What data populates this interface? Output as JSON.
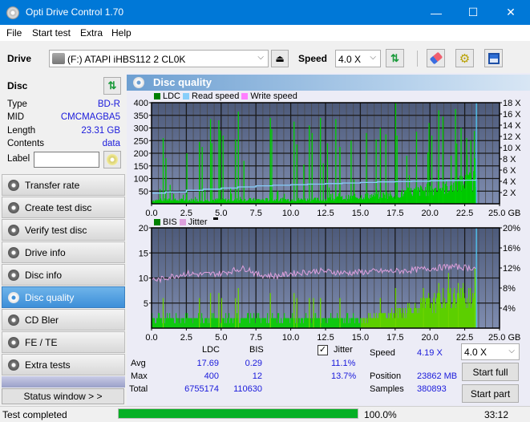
{
  "window": {
    "title": "Opti Drive Control 1.70",
    "minimize": "—",
    "maximize": "☐",
    "close": "✕"
  },
  "menu": [
    "File",
    "Start test",
    "Extra",
    "Help"
  ],
  "toolbar": {
    "drive_label": "Drive",
    "drive_value": "(F:)  ATAPI iHBS112  2 CL0K",
    "speed_label": "Speed",
    "speed_value": "4.0 X",
    "icons": [
      "drive-icon",
      "eject-icon",
      "refresh-icon",
      "eraser-icon",
      "settings-icon",
      "save-icon"
    ]
  },
  "disc": {
    "header": "Disc",
    "fields": [
      {
        "key": "Type",
        "value": "BD-R"
      },
      {
        "key": "MID",
        "value": "CMCMAGBA5"
      },
      {
        "key": "Length",
        "value": "23.31 GB"
      },
      {
        "key": "Contents",
        "value": "data"
      }
    ],
    "label_key": "Label",
    "label_value": ""
  },
  "nav": [
    {
      "label": "Transfer rate",
      "active": false
    },
    {
      "label": "Create test disc",
      "active": false
    },
    {
      "label": "Verify test disc",
      "active": false
    },
    {
      "label": "Drive info",
      "active": false
    },
    {
      "label": "Disc info",
      "active": false
    },
    {
      "label": "Disc quality",
      "active": true
    },
    {
      "label": "CD Bler",
      "active": false
    },
    {
      "label": "FE / TE",
      "active": false
    },
    {
      "label": "Extra tests",
      "active": false
    }
  ],
  "status_window_label": "Status window > >",
  "main": {
    "title": "Disc quality"
  },
  "chart_data": [
    {
      "type": "bar",
      "title": "LDC",
      "legend": [
        "LDC",
        "Read speed",
        "Write speed"
      ],
      "legend_colors": {
        "LDC": "#008000",
        "Read speed": "#87cefa",
        "Write speed": "#ff80ff"
      },
      "xlabel": "GB",
      "x_range": [
        0,
        25
      ],
      "x_ticks": [
        "0.0",
        "2.5",
        "5.0",
        "7.5",
        "10.0",
        "12.5",
        "15.0",
        "17.5",
        "20.0",
        "22.5",
        "25.0 GB"
      ],
      "y_range": [
        0,
        400
      ],
      "y_ticks": [
        "400",
        "350",
        "300",
        "250",
        "200",
        "150",
        "100",
        "50"
      ],
      "y2_range": [
        0,
        18
      ],
      "y2_ticks": [
        "18 X",
        "16 X",
        "14 X",
        "12 X",
        "10 X",
        "8 X",
        "6 X",
        "4 X",
        "2 X"
      ],
      "data_end_gb": 23.31,
      "ldc_baseline": [
        [
          0,
          15
        ],
        [
          12.5,
          18
        ],
        [
          15,
          30
        ],
        [
          17.5,
          40
        ],
        [
          20,
          60
        ],
        [
          22,
          80
        ],
        [
          23.3,
          100
        ]
      ],
      "ldc_spikes": [
        [
          0.8,
          260
        ],
        [
          1.0,
          180
        ],
        [
          1.3,
          75
        ],
        [
          2.5,
          200
        ],
        [
          3.4,
          245
        ],
        [
          3.6,
          225
        ],
        [
          4.2,
          335
        ],
        [
          4.3,
          240
        ],
        [
          4.8,
          330
        ],
        [
          4.9,
          290
        ],
        [
          5.1,
          270
        ],
        [
          6.0,
          255
        ],
        [
          6.2,
          365
        ],
        [
          6.6,
          170
        ],
        [
          8.5,
          340
        ],
        [
          8.6,
          295
        ],
        [
          10.2,
          325
        ],
        [
          10.4,
          235
        ],
        [
          10.9,
          155
        ],
        [
          11.3,
          310
        ],
        [
          11.5,
          280
        ],
        [
          12.1,
          340
        ],
        [
          12.3,
          160
        ],
        [
          12.6,
          240
        ],
        [
          13.2,
          335
        ],
        [
          13.5,
          225
        ],
        [
          14.3,
          250
        ],
        [
          15.4,
          280
        ],
        [
          16.1,
          255
        ],
        [
          16.4,
          300
        ],
        [
          16.8,
          275
        ],
        [
          17.5,
          400
        ],
        [
          17.6,
          270
        ],
        [
          18.3,
          190
        ],
        [
          19.0,
          285
        ],
        [
          19.9,
          320
        ],
        [
          20.1,
          270
        ],
        [
          20.6,
          370
        ],
        [
          20.9,
          345
        ],
        [
          21.8,
          375
        ],
        [
          22.2,
          300
        ],
        [
          22.6,
          260
        ],
        [
          22.9,
          250
        ],
        [
          23.2,
          180
        ]
      ],
      "read_speed_x": [
        [
          0,
          1.9
        ],
        [
          1.0,
          2.1
        ],
        [
          2.5,
          2.4
        ],
        [
          3.7,
          2.6
        ],
        [
          5.0,
          2.8
        ],
        [
          6.2,
          3.0
        ],
        [
          7.5,
          3.2
        ],
        [
          8.7,
          3.3
        ],
        [
          10.0,
          3.4
        ],
        [
          11.2,
          3.5
        ],
        [
          12.5,
          3.6
        ],
        [
          13.7,
          3.7
        ],
        [
          15.0,
          3.8
        ],
        [
          16.2,
          3.9
        ],
        [
          17.5,
          3.95
        ],
        [
          18.7,
          4.0
        ],
        [
          20.0,
          4.1
        ],
        [
          21.2,
          4.15
        ],
        [
          22.5,
          4.2
        ],
        [
          23.3,
          4.35
        ]
      ]
    },
    {
      "type": "bar",
      "title": "BIS",
      "legend": [
        "BIS",
        "Jitter"
      ],
      "legend_colors": {
        "BIS": "#008000",
        "Jitter": "#dda0dd"
      },
      "xlabel": "GB",
      "x_range": [
        0,
        25
      ],
      "x_ticks": [
        "0.0",
        "2.5",
        "5.0",
        "7.5",
        "10.0",
        "12.5",
        "15.0",
        "17.5",
        "20.0",
        "22.5",
        "25.0 GB"
      ],
      "y_range": [
        0,
        20
      ],
      "y_ticks": [
        "20",
        "15",
        "10",
        "5"
      ],
      "y2_range": [
        0,
        20
      ],
      "y2_ticks": [
        "20%",
        "16%",
        "12%",
        "8%",
        "4%"
      ],
      "data_end_gb": 23.31,
      "bis_baseline": [
        [
          0,
          2
        ],
        [
          15,
          2
        ],
        [
          17.5,
          3
        ],
        [
          20,
          5
        ],
        [
          23.3,
          7
        ]
      ],
      "bis_spikes": [
        [
          0.8,
          6
        ],
        [
          3.4,
          6
        ],
        [
          4.2,
          7
        ],
        [
          4.8,
          7
        ],
        [
          5.0,
          6
        ],
        [
          6.0,
          6
        ],
        [
          6.2,
          8
        ],
        [
          8.5,
          7
        ],
        [
          10.2,
          7
        ],
        [
          10.4,
          6
        ],
        [
          11.3,
          6
        ],
        [
          11.6,
          6
        ],
        [
          12.1,
          6
        ],
        [
          13.5,
          6
        ],
        [
          16.4,
          6
        ],
        [
          17.5,
          8
        ],
        [
          19.5,
          8
        ],
        [
          20.6,
          9
        ],
        [
          21.3,
          11
        ],
        [
          22.0,
          9
        ],
        [
          23.2,
          12
        ]
      ],
      "jitter_pct": [
        [
          0,
          9.8
        ],
        [
          0.5,
          9.6
        ],
        [
          1.5,
          10.4
        ],
        [
          2.5,
          10.9
        ],
        [
          3.5,
          10.7
        ],
        [
          5.0,
          10.9
        ],
        [
          6.0,
          11.6
        ],
        [
          6.5,
          11.9
        ],
        [
          7.0,
          11.8
        ],
        [
          7.5,
          10.7
        ],
        [
          9.0,
          10.4
        ],
        [
          10.0,
          10.9
        ],
        [
          12.0,
          11.4
        ],
        [
          14.0,
          11.0
        ],
        [
          16.0,
          11.3
        ],
        [
          18.0,
          11.4
        ],
        [
          20.0,
          11.9
        ],
        [
          21.5,
          12.3
        ],
        [
          22.5,
          12.1
        ],
        [
          23.3,
          12.0
        ]
      ]
    }
  ],
  "stats": {
    "col_ldc": "LDC",
    "col_bis": "BIS",
    "jitter_label": "Jitter",
    "jitter_checked": true,
    "rows": [
      {
        "label": "Avg",
        "ldc": "17.69",
        "bis": "0.29",
        "jitter": "11.1%"
      },
      {
        "label": "Max",
        "ldc": "400",
        "bis": "12",
        "jitter": "13.7%"
      },
      {
        "label": "Total",
        "ldc": "6755174",
        "bis": "110630",
        "jitter": ""
      }
    ],
    "speed_label": "Speed",
    "speed_value": "4.19 X",
    "position_label": "Position",
    "position_value": "23862 MB",
    "samples_label": "Samples",
    "samples_value": "380893",
    "speed_select": "4.0 X",
    "start_full": "Start full",
    "start_part": "Start part"
  },
  "statusbar": {
    "text": "Test completed",
    "progress": 100.0,
    "progress_text": "100.0%",
    "time": "33:12"
  }
}
